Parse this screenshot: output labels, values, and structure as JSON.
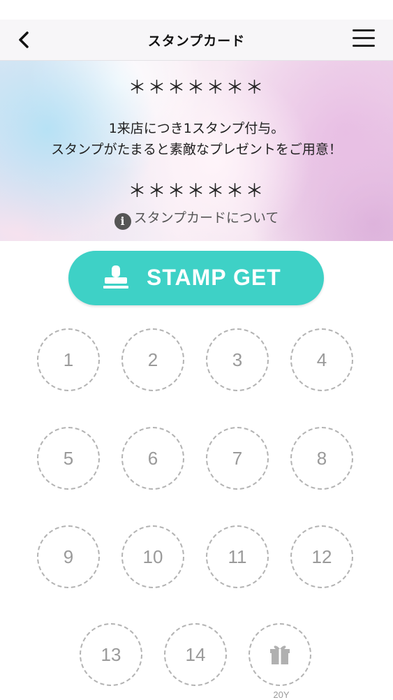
{
  "nav": {
    "title": "スタンプカード",
    "back_icon": "chevron-left-icon",
    "menu_icon": "hamburger-menu-icon"
  },
  "banner": {
    "top_mask": "＊＊＊＊＊＊＊",
    "line1": "1来店につき1スタンプ付与。",
    "line2": "スタンプがたまると素敵なプレゼントをご用意！",
    "bottom_mask": "＊＊＊＊＊＊＊",
    "about_link": "スタンプカードについて",
    "info_icon": "info-icon"
  },
  "stamp_button": {
    "label": "STAMP GET",
    "icon": "stamp-icon",
    "color": "#3ed1c6"
  },
  "stamp_slots": [
    "1",
    "2",
    "3",
    "4",
    "5",
    "6",
    "7",
    "8",
    "9",
    "10",
    "11",
    "12",
    "13",
    "14"
  ],
  "reward_slot": {
    "icon": "gift-icon",
    "label": "20Y"
  }
}
